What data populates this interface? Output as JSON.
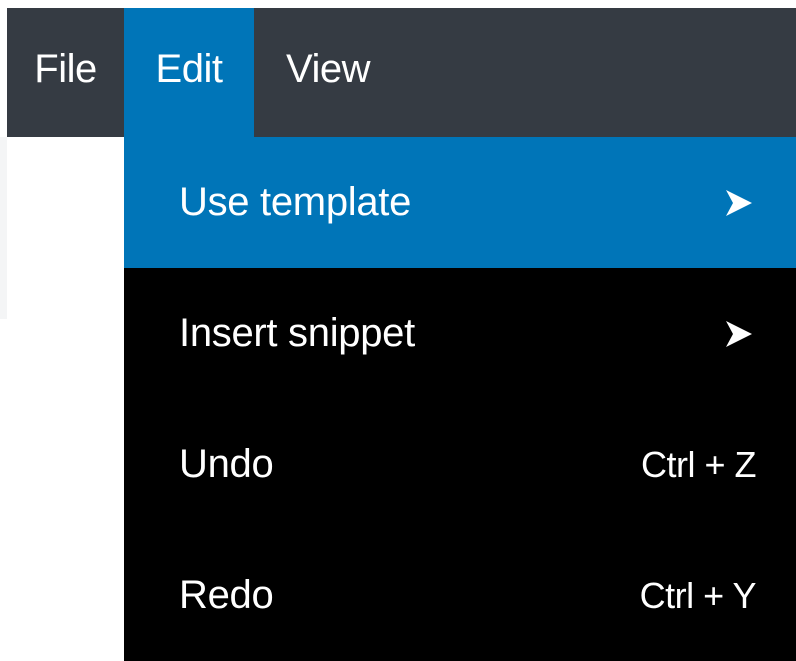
{
  "menubar": {
    "items": [
      {
        "label": "File"
      },
      {
        "label": "Edit",
        "active": true
      },
      {
        "label": "View"
      }
    ]
  },
  "dropdown": {
    "items": [
      {
        "label": "Use template",
        "submenu_icon": "chevron-right-icon",
        "highlighted": true
      },
      {
        "label": "Insert snippet",
        "submenu_icon": "chevron-right-icon"
      },
      {
        "label": "Undo",
        "shortcut": "Ctrl + Z"
      },
      {
        "label": "Redo",
        "shortcut": "Ctrl + Y"
      }
    ]
  },
  "colors": {
    "menubar_bg": "#353b43",
    "active_blue": "#0075b8",
    "dropdown_bg": "#000000",
    "text": "#ffffff"
  }
}
